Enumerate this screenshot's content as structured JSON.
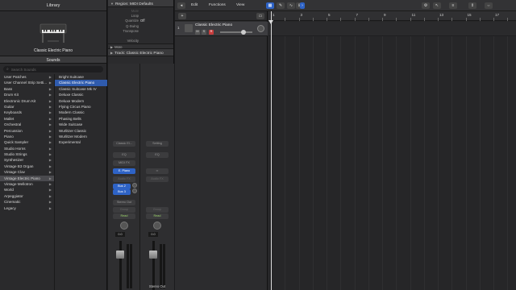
{
  "library": {
    "title": "Library",
    "patch_name": "Classic Electric Piano",
    "sounds_label": "Sounds",
    "search_placeholder": "Search Sounds",
    "categories": [
      "User Patches",
      "User Channel Strip Setti...",
      "Bass",
      "Drum Kit",
      "Electronic Drum Kit",
      "Guitar",
      "Keyboards",
      "Mallet",
      "Orchestral",
      "Percussion",
      "Piano",
      "Quick Sampler",
      "Studio Horns",
      "Studio Strings",
      "Synthesizer",
      "Vintage B3 Organ",
      "Vintage Clav",
      "Vintage Electric Piano",
      "Vintage Mellotron",
      "World",
      "Arpeggiator",
      "Cinematic",
      "Legacy"
    ],
    "selected_category": "Vintage Electric Piano",
    "patches": [
      "Bright Suitcase",
      "Classic Electric Piano",
      "Classic Suitcase Mk IV",
      "Deluxe Classic",
      "Deluxe Modern",
      "Flying Circus Piano",
      "Modern Classic",
      "Phasing Bells",
      "Wide Suitcase",
      "Wurlitzer Classic",
      "Wurlitzer Modern",
      "Experimental"
    ],
    "selected_patch": "Classic Electric Piano"
  },
  "inspector": {
    "region_header": "Region: MIDI Defaults",
    "region_params": [
      {
        "k": "Mute",
        "v": "",
        "dim": true
      },
      {
        "k": "Loop",
        "v": "",
        "dim": false
      },
      {
        "k": "Quantize",
        "v": "Off",
        "dim": false
      },
      {
        "k": "Q-Swing",
        "v": "",
        "dim": false
      },
      {
        "k": "Transpose",
        "v": "",
        "dim": false
      },
      {
        "k": "",
        "v": "",
        "dim": true
      },
      {
        "k": "Velocity",
        "v": "",
        "dim": false
      }
    ],
    "more_label": "More",
    "track_header": "Track:",
    "track_name": "Classic Electric Piano",
    "strip_a": {
      "slot_setting": "Classic El...",
      "slot_eq": "EQ",
      "slot_midi_fx": "MIDI FX",
      "slot_instrument": "E. Piano",
      "slot_audio_fx": "Audio FX",
      "slot_bus2": "Bus 2",
      "slot_bus3": "Bus 3",
      "slot_output": "Stereo Out",
      "slot_group": "Group",
      "slot_read": "Read",
      "value": "0.0"
    },
    "strip_b": {
      "slot_setting": "Setting",
      "slot_eq": "EQ",
      "slot_link": "∞",
      "slot_audio_fx": "Audio FX",
      "slot_group": "Group",
      "slot_read": "Read",
      "value": "0.0",
      "name": "Stereo Out"
    }
  },
  "toolbar": {
    "edit": "Edit",
    "functions": "Functions",
    "view": "View",
    "add_icon": "+",
    "add_label": "+"
  },
  "track": {
    "number": "1",
    "name": "Classic Electric Piano",
    "mute": "M",
    "solo": "S",
    "record": "R",
    "volume": 0.72
  },
  "ruler": {
    "bars": [
      "1",
      "3",
      "5",
      "7",
      "9",
      "11",
      "13",
      "15",
      "17"
    ]
  }
}
